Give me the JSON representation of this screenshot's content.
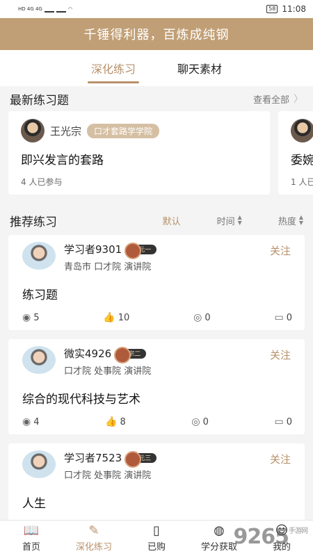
{
  "status": {
    "left": "HD 4G 4G",
    "battery": "58",
    "time": "11:08"
  },
  "banner": {
    "text": "千锤得利器，百炼成纯钢"
  },
  "tabs": [
    {
      "label": "深化练习",
      "active": true
    },
    {
      "label": "聊天素材",
      "active": false
    }
  ],
  "latest": {
    "title": "最新练习题",
    "view_all": "查看全部",
    "cards": [
      {
        "author": "王光宗",
        "college": "口才套路学学院",
        "title": "即兴发言的套路",
        "participants": "4 人已参与"
      },
      {
        "title": "委婉",
        "participants": "1 人已"
      }
    ]
  },
  "recommended": {
    "title": "推荐练习",
    "sort_default": "默认",
    "sort_time": "时间",
    "sort_hot": "热度",
    "posts": [
      {
        "user": "学习者9301",
        "rank": "元一",
        "location": "青岛市 口才院 演讲院",
        "follow": "关注",
        "title": "练习题",
        "views": "5",
        "likes": "10",
        "rewards": "0",
        "comments": "0"
      },
      {
        "user": "微实4926",
        "rank": "宗二",
        "location": "口才院 处事院 演讲院",
        "follow": "关注",
        "title": "综合的现代科技与艺术",
        "views": "4",
        "likes": "8",
        "rewards": "0",
        "comments": "0"
      },
      {
        "user": "学习者7523",
        "rank": "元三",
        "location": "口才院 处事院 演讲院",
        "follow": "关注",
        "title": "人生",
        "views": "",
        "likes": "",
        "rewards": "",
        "comments": ""
      }
    ]
  },
  "nav": [
    {
      "label": "首页",
      "icon": "book-icon"
    },
    {
      "label": "深化练习",
      "icon": "pencil-icon"
    },
    {
      "label": "已购",
      "icon": "bookmark-icon"
    },
    {
      "label": "学分获取",
      "icon": "coins-icon"
    },
    {
      "label": "我的",
      "icon": "person-icon"
    }
  ],
  "watermark": {
    "text": "9265",
    "sub": "手游网"
  },
  "colors": {
    "accent": "#b7916a",
    "banner": "#c19f76"
  }
}
